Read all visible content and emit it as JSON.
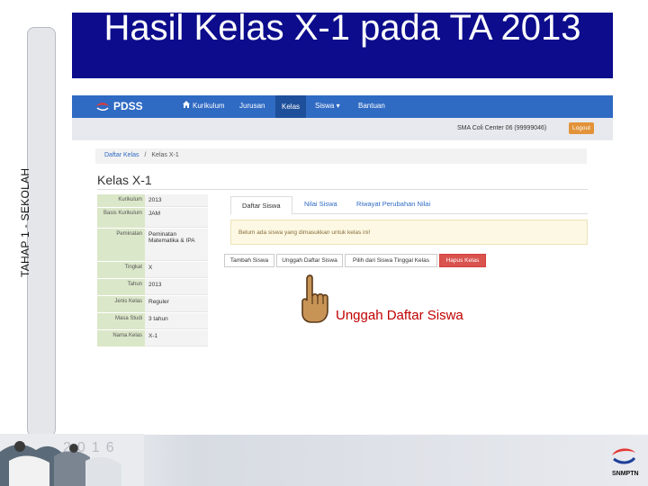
{
  "slide": {
    "side_label": "TAHAP 1 - SEKOLAH",
    "title": "Hasil Kelas X-1 pada TA 2013",
    "caption": "Unggah Daftar Siswa",
    "year": "2016",
    "footer_logo_text": "SNMPTN"
  },
  "app": {
    "brand": "PDSS",
    "nav": [
      "Kurikulum",
      "Jurusan",
      "Kelas",
      "Siswa ▾",
      "Bantuan"
    ],
    "active_nav": "Kelas",
    "school": "SMA Coli Center 06 (99999046)",
    "logout": "Logout",
    "breadcrumb": {
      "parent": "Daftar Kelas",
      "separator": "/",
      "current": "Kelas X-1"
    },
    "heading": "Kelas X-1",
    "info": [
      {
        "key": "Kurikulum",
        "value": "2013"
      },
      {
        "key": "Basis Kurikulum",
        "value": "JAM"
      },
      {
        "key": "Peminatan",
        "value": "Peminatan Matematika & IPA"
      },
      {
        "key": "Tingkat",
        "value": "X"
      },
      {
        "key": "Tahun",
        "value": "2013"
      },
      {
        "key": "Jenis Kelas",
        "value": "Reguler"
      },
      {
        "key": "Masa Studi",
        "value": "3 tahun"
      },
      {
        "key": "Nama Kelas",
        "value": "X-1"
      }
    ],
    "tabs": [
      "Daftar Siswa",
      "Nilai Siswa",
      "Riwayat Perubahan Nilai"
    ],
    "alert": "Belum ada siswa yang dimasukkan untuk kelas ini!",
    "buttons": [
      "Tambah Siswa",
      "Unggah Daftar Siswa",
      "Pilih dari Siswa Tinggal Kelas",
      "Hapus Kelas"
    ]
  },
  "colors": {
    "title_bg": "#0c0c8c",
    "navbar": "#2f6ac3",
    "caption": "#c00000",
    "danger": "#d9534f"
  }
}
